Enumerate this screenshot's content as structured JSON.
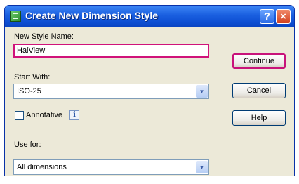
{
  "dialog": {
    "title": "Create New Dimension Style",
    "title_buttons": {
      "help": "?",
      "close": "×"
    }
  },
  "form": {
    "new_style_name_label": "New Style Name:",
    "new_style_name_value": "HalView",
    "start_with_label": "Start With:",
    "start_with_value": "ISO-25",
    "annotative_label": "Annotative",
    "annotative_checked": false,
    "use_for_label": "Use for:",
    "use_for_value": "All dimensions"
  },
  "buttons": {
    "continue": "Continue",
    "cancel": "Cancel",
    "help": "Help"
  },
  "colors": {
    "titlebar": "#0d4ed2",
    "dialog_bg": "#ece9d8",
    "highlight": "#d0127a"
  }
}
